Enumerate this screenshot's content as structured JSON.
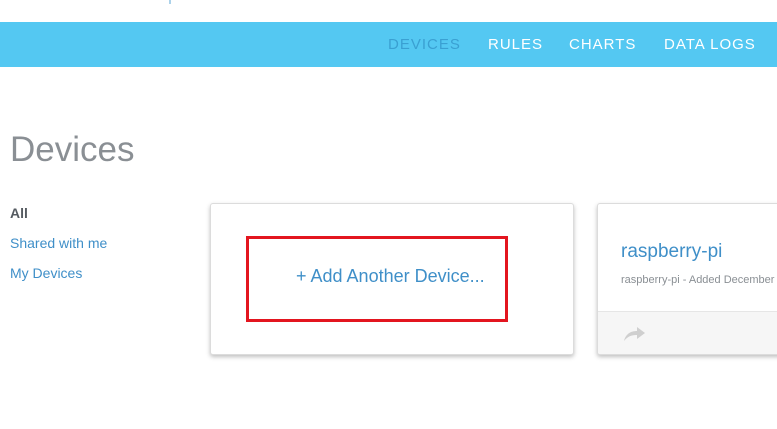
{
  "nav": {
    "items": [
      {
        "label": "DEVICES",
        "active": true
      },
      {
        "label": "RULES"
      },
      {
        "label": "CHARTS"
      },
      {
        "label": "DATA LOGS"
      }
    ]
  },
  "page": {
    "title": "Devices"
  },
  "filters": {
    "items": [
      {
        "label": "All",
        "active": true
      },
      {
        "label": "Shared with me"
      },
      {
        "label": "My Devices"
      }
    ]
  },
  "cards": {
    "add_label": "+ Add Another Device...",
    "device": {
      "name": "raspberry-pi",
      "subtitle": "raspberry-pi - Added December",
      "footer_icon": "share-arrow-icon"
    }
  },
  "colors": {
    "navbar": "#54c8f2",
    "nav_active": "#3aa0d2",
    "link": "#3f8fc8",
    "highlight": "#e3151f"
  }
}
